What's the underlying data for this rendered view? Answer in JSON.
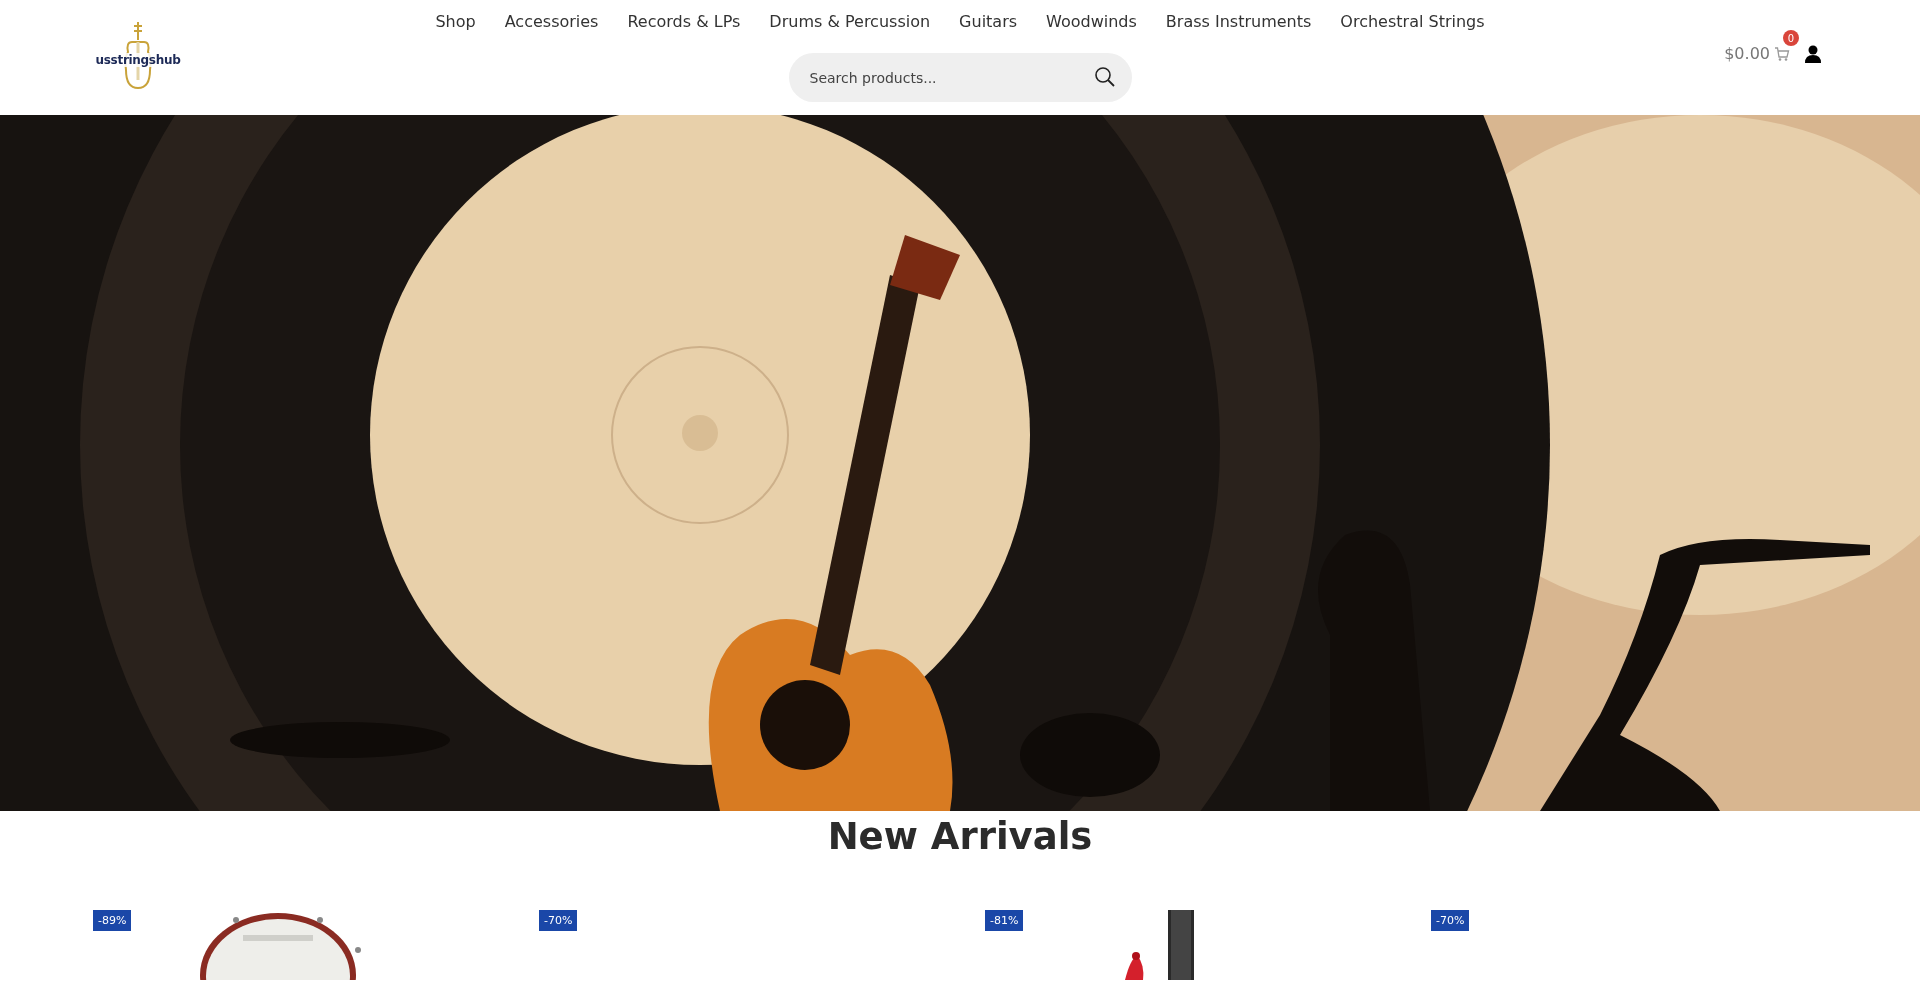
{
  "header": {
    "logo": {
      "text": "usstringshub"
    },
    "nav": [
      {
        "label": "Shop"
      },
      {
        "label": "Accessories"
      },
      {
        "label": "Records & LPs"
      },
      {
        "label": "Drums & Percussion"
      },
      {
        "label": "Guitars"
      },
      {
        "label": "Woodwinds"
      },
      {
        "label": "Brass Instruments"
      },
      {
        "label": "Orchestral Strings"
      }
    ],
    "search": {
      "placeholder": "Search products..."
    },
    "cart": {
      "total": "$0.00",
      "count": "0"
    }
  },
  "new_arrivals": {
    "title": "New Arrivals",
    "products": [
      {
        "badge": "-89%",
        "kind": "drum"
      },
      {
        "badge": "-70%",
        "kind": "blank"
      },
      {
        "badge": "-81%",
        "kind": "guitar"
      },
      {
        "badge": "-70%",
        "kind": "blank"
      }
    ]
  }
}
